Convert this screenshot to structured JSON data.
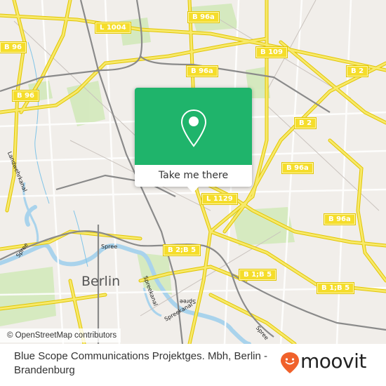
{
  "map": {
    "city_label": "Berlin",
    "water_labels": [
      "Spree",
      "Spree",
      "Spree",
      "Spree",
      "Spreekanal",
      "Spreekanal",
      "Landwehrkanal"
    ],
    "road_shields": [
      "L 1004",
      "B 96a",
      "B 96",
      "B 96",
      "B 109",
      "B 96a",
      "B 2",
      "B 2",
      "B 96a",
      "L 1129",
      "B 96a",
      "B 2;B 5",
      "B 1;B 5",
      "B 1;B 5"
    ],
    "attribution": "© OpenStreetMap contributors"
  },
  "popup": {
    "icon": "map-pin-icon",
    "button_label": "Take me there",
    "accent_color": "#1fb46b"
  },
  "footer": {
    "place_title": "Blue Scope Communications Projektges. Mbh, Berlin - Brandenburg",
    "brand": "moovit",
    "brand_color": "#f0612b"
  }
}
